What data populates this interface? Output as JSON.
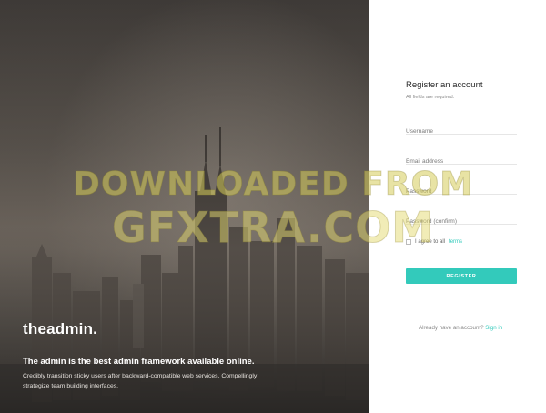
{
  "hero": {
    "brand": "theadmin.",
    "tagline": "The admin is the best admin framework available online.",
    "description": "Credibly transition sticky users after backward-compatible web services. Compellingly strategize team building interfaces."
  },
  "form": {
    "title": "Register an account",
    "subtitle": "All fields are required.",
    "fields": [
      {
        "placeholder": "Username",
        "value": ""
      },
      {
        "placeholder": "Email address",
        "value": ""
      },
      {
        "placeholder": "Password",
        "value": ""
      },
      {
        "placeholder": "Password (confirm)",
        "value": ""
      }
    ],
    "agree_text": "I agree to all",
    "agree_link": "terms",
    "agree_checked": false,
    "submit_label": "REGISTER",
    "signin_text": "Already have an account?",
    "signin_link": "Sign in"
  },
  "watermark": {
    "line1": "DOWNLOADED FROM",
    "line2": "GFXTRA.COM"
  },
  "colors": {
    "accent": "#33cabb",
    "hero_dark": "#3e3a37"
  },
  "icons": [
    "skyline-illustration"
  ]
}
